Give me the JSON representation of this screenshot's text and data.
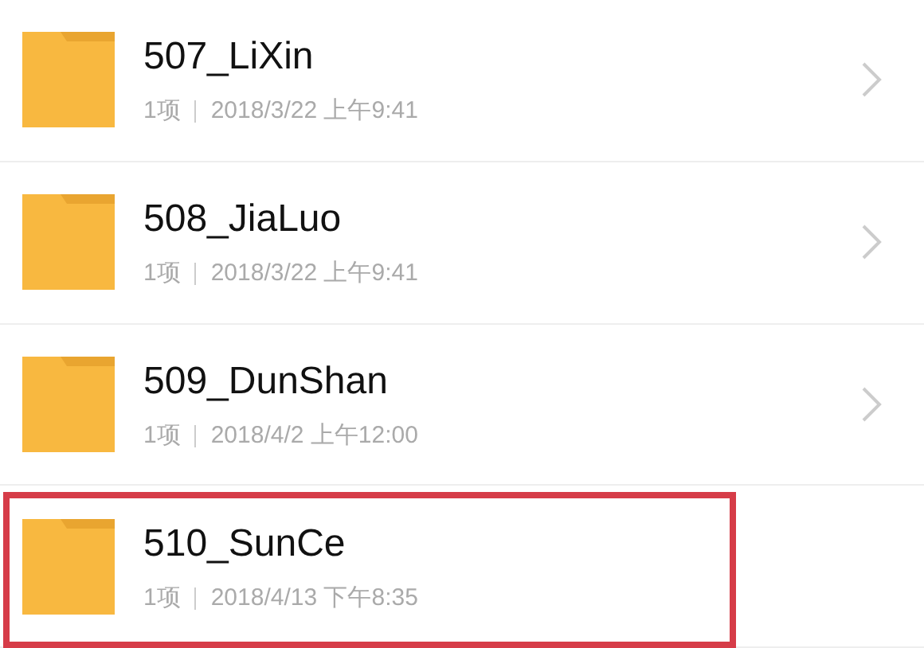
{
  "folders": [
    {
      "name": "507_LiXin",
      "count": "1项",
      "date": "2018/3/22 上午9:41",
      "chevron": true,
      "highlighted": false
    },
    {
      "name": "508_JiaLuo",
      "count": "1项",
      "date": "2018/3/22 上午9:41",
      "chevron": true,
      "highlighted": false
    },
    {
      "name": "509_DunShan",
      "count": "1项",
      "date": "2018/4/2 上午12:00",
      "chevron": true,
      "highlighted": false
    },
    {
      "name": "510_SunCe",
      "count": "1项",
      "date": "2018/4/13 下午8:35",
      "chevron": false,
      "highlighted": true
    }
  ]
}
